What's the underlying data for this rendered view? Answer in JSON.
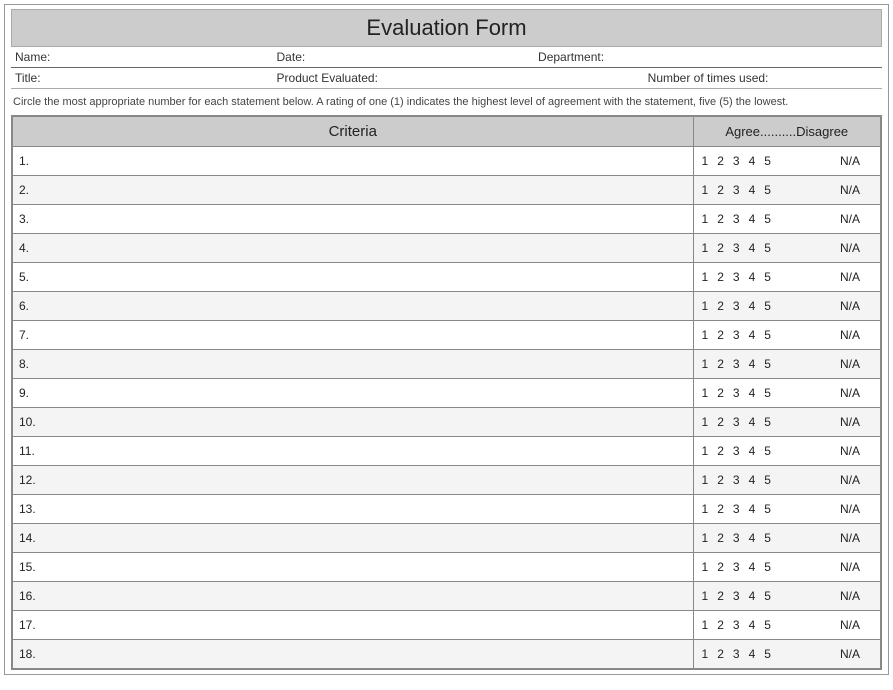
{
  "title": "Evaluation Form",
  "meta_row1": {
    "name_label": "Name:",
    "date_label": "Date:",
    "dept_label": "Department:"
  },
  "meta_row2": {
    "title_label": "Title:",
    "product_label": "Product Evaluated:",
    "times_label": "Number of times used:"
  },
  "instructions": "Circle the most appropriate number for each statement below. A rating of one (1) indicates the highest level of agreement with  the statement, five (5) the lowest.",
  "table_headers": {
    "criteria": "Criteria",
    "rating": "Agree..........Disagree"
  },
  "rating_options": [
    "1",
    "2",
    "3",
    "4",
    "5"
  ],
  "rating_na": "N/A",
  "rows": [
    {
      "num": "1."
    },
    {
      "num": "2."
    },
    {
      "num": "3."
    },
    {
      "num": "4."
    },
    {
      "num": "5."
    },
    {
      "num": "6."
    },
    {
      "num": "7."
    },
    {
      "num": "8."
    },
    {
      "num": "9."
    },
    {
      "num": "10."
    },
    {
      "num": "11."
    },
    {
      "num": "12."
    },
    {
      "num": "13."
    },
    {
      "num": "14."
    },
    {
      "num": "15."
    },
    {
      "num": "16."
    },
    {
      "num": "17."
    },
    {
      "num": "18."
    }
  ]
}
